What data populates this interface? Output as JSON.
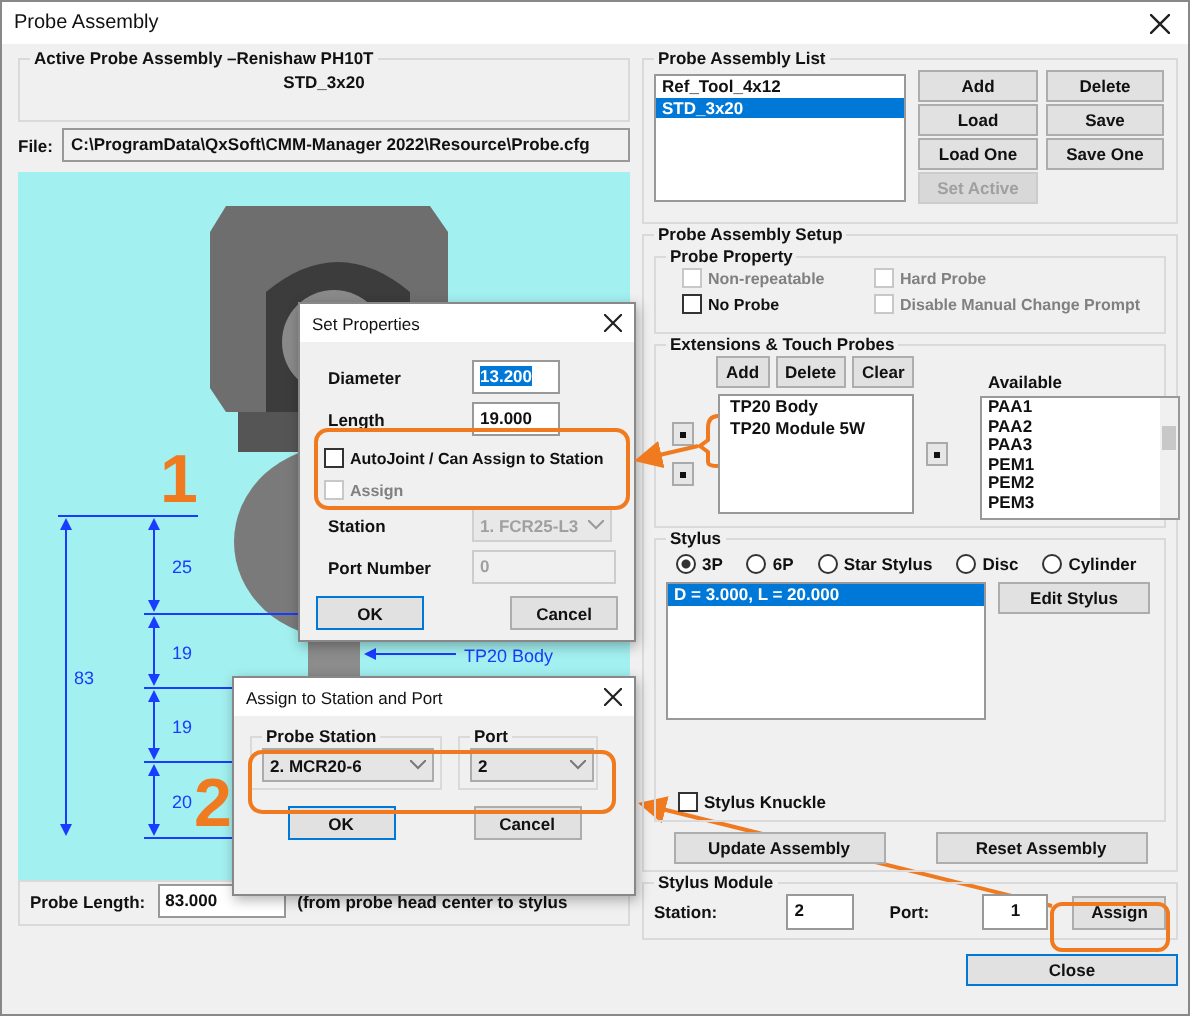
{
  "window": {
    "title": "Probe Assembly"
  },
  "active_assembly": {
    "title": "Active Probe Assembly  –Renishaw PH10T",
    "name": "STD_3x20"
  },
  "file": {
    "label": "File:",
    "value": "C:\\ProgramData\\QxSoft\\CMM-Manager 2022\\Resource\\Probe.cfg"
  },
  "canvas": {
    "segments": [
      {
        "label": "25"
      },
      {
        "label": "19"
      },
      {
        "label": "19"
      },
      {
        "label": "20"
      }
    ],
    "total": "83",
    "callout": "TP20 Body"
  },
  "probe_length": {
    "label": "Probe Length:",
    "value": "83.000",
    "note": "(from probe head center to stylus"
  },
  "assembly_list": {
    "title": "Probe Assembly List",
    "items": [
      {
        "label": "Ref_Tool_4x12",
        "selected": false
      },
      {
        "label": "STD_3x20",
        "selected": true
      }
    ],
    "buttons": [
      {
        "label": "Add",
        "disabled": false
      },
      {
        "label": "Delete",
        "disabled": false
      },
      {
        "label": "Load",
        "disabled": false
      },
      {
        "label": "Save",
        "disabled": false
      },
      {
        "label": "Load One",
        "disabled": false
      },
      {
        "label": "Save One",
        "disabled": false
      },
      {
        "label": "Set Active",
        "disabled": true
      }
    ]
  },
  "setup": {
    "title": "Probe Assembly Setup",
    "property": {
      "title": "Probe Property",
      "options": [
        {
          "label": "Non-repeatable",
          "checked": false,
          "disabled": true
        },
        {
          "label": "Hard Probe",
          "checked": false,
          "disabled": true
        },
        {
          "label": "No Probe",
          "checked": false,
          "disabled": false
        },
        {
          "label": "Disable Manual Change Prompt",
          "checked": false,
          "disabled": true
        }
      ]
    },
    "extensions": {
      "title": "Extensions & Touch Probes",
      "buttons": [
        "Add",
        "Delete",
        "Clear"
      ],
      "items": [
        "TP20 Body",
        "TP20 Module 5W"
      ],
      "available_label": "Available",
      "available": [
        "PAA1",
        "PAA2",
        "PAA3",
        "PEM1",
        "PEM2",
        "PEM3"
      ]
    },
    "stylus": {
      "title": "Stylus",
      "types": [
        {
          "label": "3P",
          "selected": true
        },
        {
          "label": "6P",
          "selected": false
        },
        {
          "label": "Star Stylus",
          "selected": false
        },
        {
          "label": "Disc",
          "selected": false
        },
        {
          "label": "Cylinder",
          "selected": false
        }
      ],
      "items": [
        {
          "label": "D = 3.000, L = 20.000",
          "selected": true
        }
      ],
      "edit_button": "Edit Stylus",
      "knuckle": {
        "label": "Stylus Knuckle",
        "checked": false
      }
    },
    "buttons": [
      "Update Assembly",
      "Reset Assembly"
    ]
  },
  "stylus_module": {
    "title": "Stylus Module",
    "station_label": "Station:",
    "station": "2",
    "port_label": "Port:",
    "port": "1",
    "assign": "Assign"
  },
  "close_button": "Close",
  "set_properties": {
    "title": "Set Properties",
    "diameter_label": "Diameter",
    "diameter": "13.200",
    "diameter_highlighted": true,
    "length_label": "Length",
    "length": "19.000",
    "autojoint": {
      "label": "AutoJoint / Can Assign to Station",
      "checked": false,
      "disabled": false
    },
    "assign": {
      "label": "Assign",
      "checked": false,
      "disabled": true
    },
    "station_label": "Station",
    "station": "1. FCR25-L3",
    "station_disabled": true,
    "port_label": "Port Number",
    "port": "0",
    "port_disabled": true,
    "ok": "OK",
    "cancel": "Cancel"
  },
  "assign_dialog": {
    "title": "Assign to Station and Port",
    "station_label": "Probe Station",
    "station": "2. MCR20-6",
    "port_label": "Port",
    "port": "2",
    "ok": "OK",
    "cancel": "Cancel"
  },
  "annotations": [
    {
      "label": "1"
    },
    {
      "label": "2"
    }
  ]
}
